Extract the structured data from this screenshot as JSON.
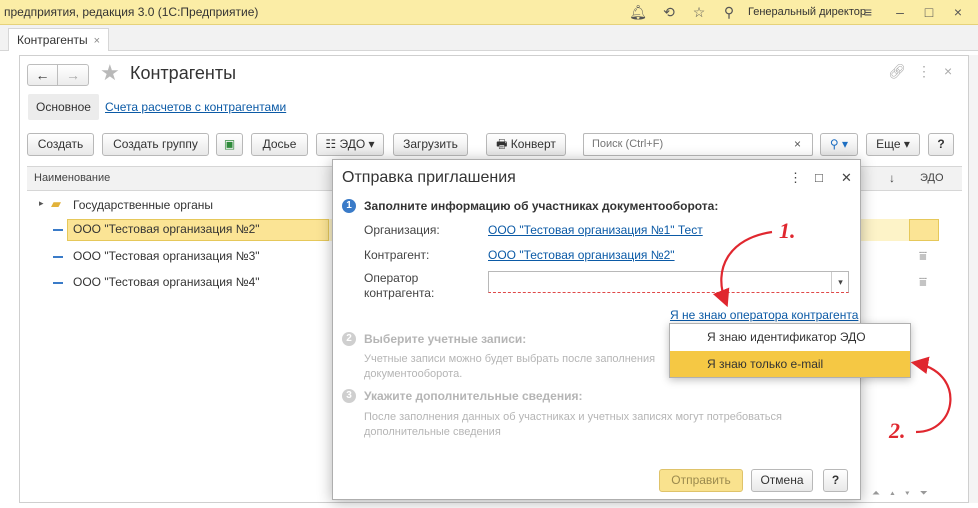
{
  "app": {
    "title": "предприятия, редакция 3.0  (1С:Предприятие)",
    "user": "Генеральный директор",
    "icons": [
      "bell-icon",
      "history-icon",
      "star-icon",
      "search-icon",
      "settings-icon",
      "minimize-icon",
      "maximize-icon",
      "close-icon"
    ]
  },
  "tabs": [
    {
      "label": "Контрагенты",
      "close": "×"
    }
  ],
  "page": {
    "title": "Контрагенты",
    "subtabs": {
      "main": "Основное",
      "link": "Счета расчетов с контрагентами"
    }
  },
  "toolbar": {
    "create": "Создать",
    "create_group": "Создать группу",
    "dossier": "Досье",
    "edo": "ЭДО",
    "load": "Загрузить",
    "envelope": "Конверт",
    "search_placeholder": "Поиск (Ctrl+F)",
    "search_clear": "×",
    "more": "Еще",
    "help": "?"
  },
  "table": {
    "columns": {
      "name": "Наименование",
      "sort": "↓",
      "edo": "ЭДО"
    },
    "rows": [
      {
        "name": "Государственные органы",
        "type": "folder"
      },
      {
        "name": "ООО \"Тестовая организация №2\"",
        "selected": true
      },
      {
        "name": "ООО \"Тестовая организация №3\""
      },
      {
        "name": "ООО \"Тестовая организация №4\""
      }
    ]
  },
  "modal": {
    "title": "Отправка приглашения",
    "step1": {
      "num": "1",
      "title": "Заполните информацию об участниках документооборота:",
      "org_label": "Организация:",
      "org_value": "ООО \"Тестовая организация №1\" Тест",
      "kontr_label": "Контрагент:",
      "kontr_value": "ООО \"Тестовая организация №2\"",
      "operator_label_1": "Оператор",
      "operator_label_2": "контрагента:",
      "operator_value": "",
      "dont_know_link": "Я не знаю оператора контрагента"
    },
    "step2": {
      "num": "2",
      "title": "Выберите учетные записи:",
      "hint_1": "Учетные записи можно будет выбрать после заполнения",
      "hint_2": "документооборота."
    },
    "step3": {
      "num": "3",
      "title": "Укажите дополнительные сведения:",
      "hint_1": "После заполнения данных об участниках и учетных записях могут потребоваться",
      "hint_2": "дополнительные сведения"
    },
    "send": "Отправить",
    "cancel": "Отмена",
    "help": "?"
  },
  "popup": {
    "item_1": "Я знаю идентификатор ЭДО",
    "item_2": "Я знаю только e-mail"
  },
  "annotations": {
    "one": "1.",
    "two": "2."
  },
  "colors": {
    "titlebar": "#fbeda6",
    "selection": "#fbe495",
    "highlight": "#f5c844",
    "link": "#0b5aa6",
    "step_active": "#3a7bc8",
    "annotation": "#e0272f"
  }
}
